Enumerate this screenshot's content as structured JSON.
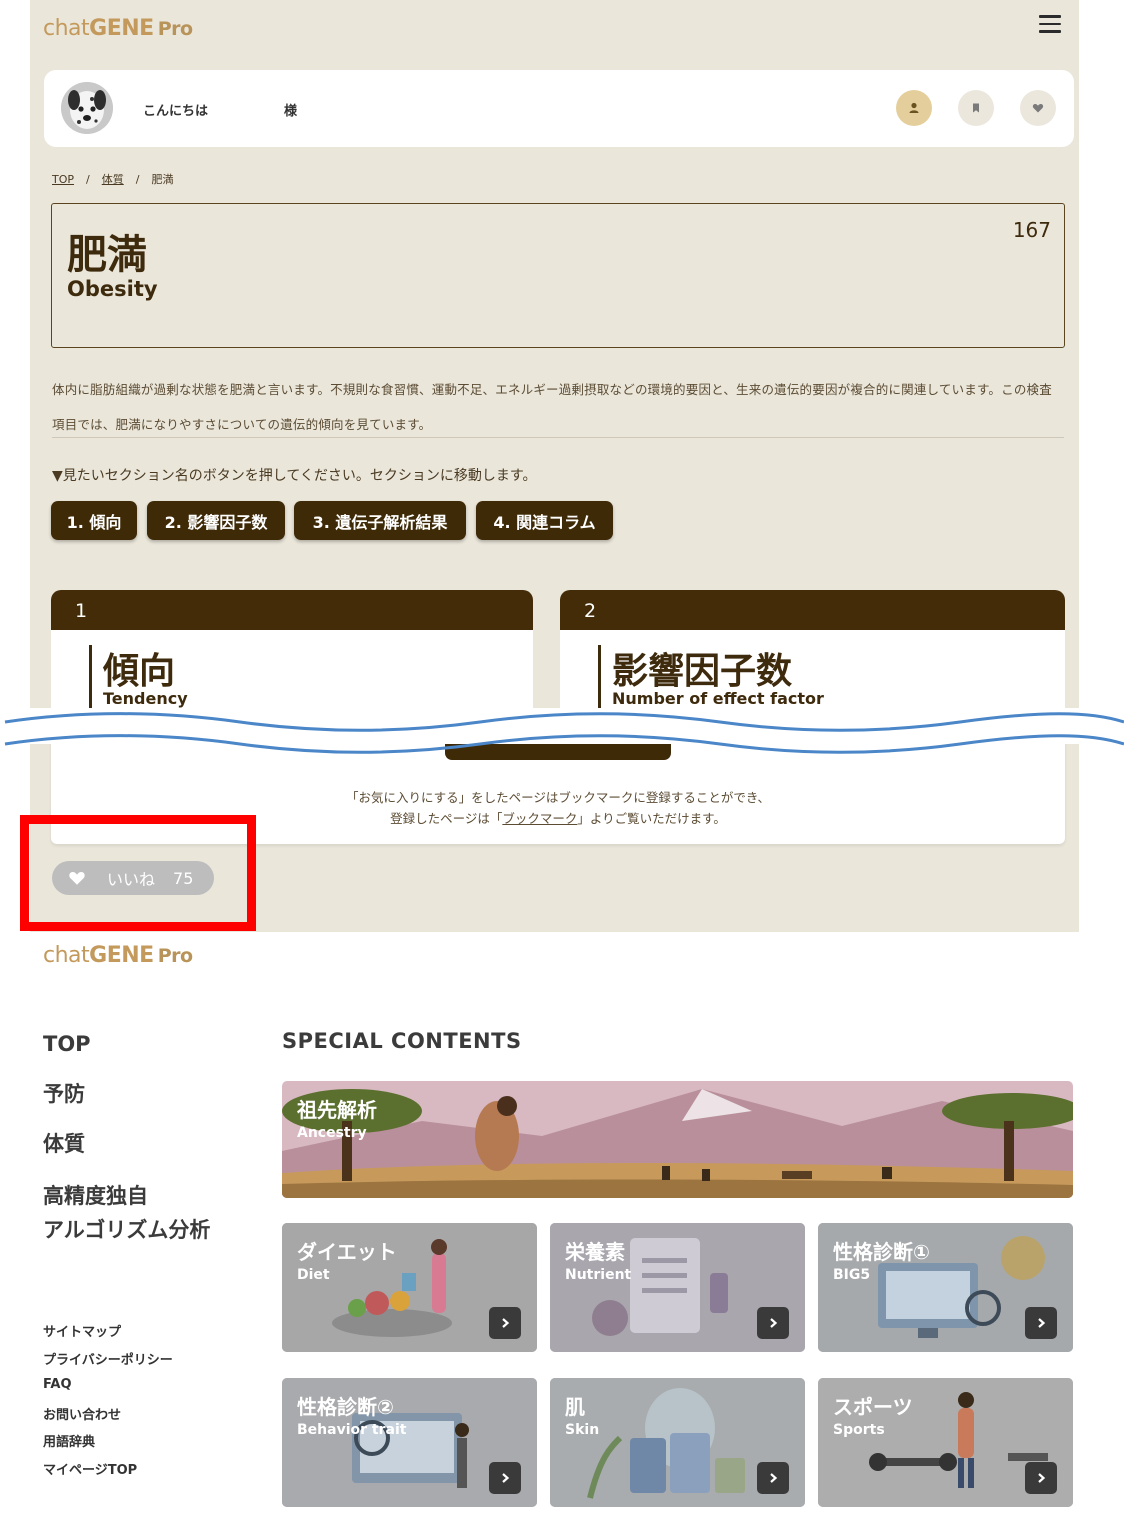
{
  "header": {
    "logo": {
      "chat": "chat",
      "gene": "GENE",
      "pro": "Pro"
    }
  },
  "user": {
    "greeting": "こんにちは",
    "honorific": "様"
  },
  "breadcrumb": [
    "TOP",
    "体質",
    "肥満"
  ],
  "item": {
    "title_jp": "肥満",
    "title_en": "Obesity",
    "count": "167",
    "description": "体内に脂肪組織が過剰な状態を肥満と言います。不規則な食習慣、運動不足、エネルギー過剰摂取などの環境的要因と、生来の遺伝的要因が複合的に関連しています。この検査項目では、肥満になりやすさについての遺伝的傾向を見ています。"
  },
  "sections": {
    "hint": "▼見たいセクション名のボタンを押してください。セクションに移動します。",
    "buttons": [
      "1. 傾向",
      "2. 影響因子数",
      "3. 遺伝子解析結果",
      "4. 関連コラム"
    ]
  },
  "cards": [
    {
      "number": "1",
      "title_jp": "傾向",
      "title_en": "Tendency"
    },
    {
      "number": "2",
      "title_jp": "影響因子数",
      "title_en": "Number of effect factor"
    }
  ],
  "bookmark": {
    "line1": "「お気に入りにする」をしたページはブックマークに登録することができ、",
    "line2_pre": "登録したページは「",
    "line2_link": "ブックマーク",
    "line2_post": "」よりご覧いただけます。"
  },
  "like": {
    "label": "いいね",
    "count": "75"
  },
  "footer": {
    "nav": [
      "TOP",
      "予防",
      "体質",
      "高精度独自",
      "アルゴリズム分析"
    ],
    "links": [
      "サイトマップ",
      "プライバシーポリシー",
      "FAQ",
      "お問い合わせ",
      "用語辞典",
      "マイページTOP"
    ],
    "special_title": "SPECIAL CONTENTS",
    "banner": {
      "jp": "祖先解析",
      "en": "Ancestry"
    },
    "tiles": [
      {
        "jp": "ダイエット",
        "en": "Diet"
      },
      {
        "jp": "栄養素",
        "en": "Nutrient"
      },
      {
        "jp": "性格診断①",
        "en": "BIG5"
      },
      {
        "jp": "性格診断②",
        "en": "Behavior trait"
      },
      {
        "jp": "肌",
        "en": "Skin"
      },
      {
        "jp": "スポーツ",
        "en": "Sports"
      }
    ]
  },
  "colors": {
    "panel_bg": "#eae6da",
    "brown": "#3f2a08",
    "logo_gold": "#c49a5c",
    "highlight_red": "#ff0000",
    "wave_blue": "#4a86c8"
  },
  "icons": [
    "hamburger-icon",
    "user-icon",
    "bookmark-icon",
    "heart-icon",
    "chevron-right-icon"
  ]
}
